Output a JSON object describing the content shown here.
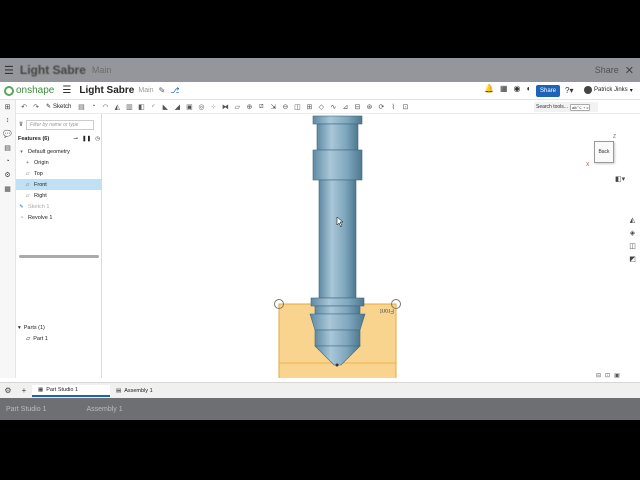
{
  "ghost": {
    "title": "Light Sabre",
    "branch": "Main",
    "share_label": "Share",
    "tab1": "Part Studio 1",
    "tab2": "Assembly 1"
  },
  "app": {
    "logo_text": "onshape",
    "document_title": "Light Sabre",
    "branch": "Main",
    "share_label": "Share",
    "help_label": "?",
    "user_name": "Patrick Jinks",
    "notifications_count": "1"
  },
  "toolbar": {
    "sketch_label": "Sketch",
    "search_placeholder": "Search tools...",
    "search_shortcut": "alt/⌥ + c"
  },
  "features": {
    "filter_placeholder": "Filter by name or type",
    "header": "Features (6)",
    "items": [
      {
        "label": "Default geometry",
        "icon": "chevron-down-icon"
      },
      {
        "label": "Origin",
        "icon": "origin-icon"
      },
      {
        "label": "Top",
        "icon": "plane-icon"
      },
      {
        "label": "Front",
        "icon": "plane-icon",
        "selected": true
      },
      {
        "label": "Right",
        "icon": "plane-icon"
      },
      {
        "label": "Sketch 1",
        "icon": "sketch-icon",
        "dimmed": true
      },
      {
        "label": "Revolve 1",
        "icon": "revolve-icon"
      }
    ],
    "parts_header": "Parts (1)",
    "part_item": "Part 1"
  },
  "viewport": {
    "plane_label": "Front",
    "view_cube_face": "Back",
    "axis_z": "Z",
    "axis_x": "X",
    "colors": {
      "part": "#7fa7bd",
      "plane_fill": "#f9d48e",
      "plane_edge": "#e8a93a"
    }
  },
  "tabs": {
    "active": "Part Studio 1",
    "inactive": "Assembly 1"
  }
}
